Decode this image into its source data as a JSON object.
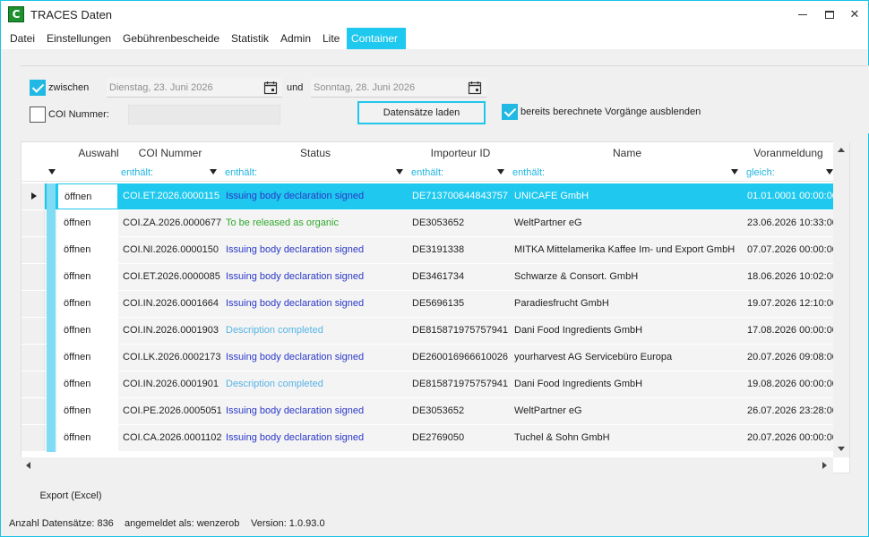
{
  "window": {
    "title": "TRACES Daten",
    "icon_letter": "C"
  },
  "menu": [
    "Datei",
    "Einstellungen",
    "Gebührenbescheide",
    "Statistik",
    "Admin",
    "Lite",
    "Container"
  ],
  "filters": {
    "between_label": "zwischen",
    "between_checked": true,
    "date_from": "Dienstag, 23. Juni 2026",
    "and_label": "und",
    "date_to": "Sonntag, 28. Juni 2026",
    "coi_label": "COI Nummer:",
    "coi_checked": false,
    "coi_value": "",
    "load_button": "Datensätze laden",
    "hide_calculated_label": "bereits berechnete Vorgänge ausblenden",
    "hide_calculated_checked": true
  },
  "grid": {
    "columns": [
      "Auswahl",
      "COI Nummer",
      "Status",
      "Importeur ID",
      "Name",
      "Voranmeldung"
    ],
    "filters": [
      "",
      "enthält:",
      "enthält:",
      "enthält:",
      "enthält:",
      "gleich:"
    ],
    "rows": [
      {
        "auswahl": "öffnen",
        "coi": "COI.ET.2026.0000115",
        "status": "Issuing body declaration signed",
        "status_style": "blue",
        "importer": "DE713700644843757",
        "name": "UNICAFE GmbH",
        "voranmeldung": "01.01.0001 00:00:00",
        "selected": true
      },
      {
        "auswahl": "öffnen",
        "coi": "COI.ZA.2026.0000677",
        "status": "To be released as organic",
        "status_style": "green",
        "importer": "DE3053652",
        "name": "WeltPartner eG",
        "voranmeldung": "23.06.2026 10:33:00"
      },
      {
        "auswahl": "öffnen",
        "coi": "COI.NI.2026.0000150",
        "status": "Issuing body declaration signed",
        "status_style": "blue",
        "importer": "DE3191338",
        "name": "MITKA Mittelamerika Kaffee Im- und Export GmbH",
        "voranmeldung": "07.07.2026 00:00:00"
      },
      {
        "auswahl": "öffnen",
        "coi": "COI.ET.2026.0000085",
        "status": "Issuing body declaration signed",
        "status_style": "blue",
        "importer": "DE3461734",
        "name": "Schwarze & Consort. GmbH",
        "voranmeldung": "18.06.2026 10:02:00"
      },
      {
        "auswahl": "öffnen",
        "coi": "COI.IN.2026.0001664",
        "status": "Issuing body declaration signed",
        "status_style": "blue",
        "importer": "DE5696135",
        "name": "Paradiesfrucht GmbH",
        "voranmeldung": "19.07.2026 12:10:00"
      },
      {
        "auswahl": "öffnen",
        "coi": "COI.IN.2026.0001903",
        "status": "Description completed",
        "status_style": "light",
        "importer": "DE815871975757941",
        "name": "Dani Food Ingredients GmbH",
        "voranmeldung": "17.08.2026 00:00:00"
      },
      {
        "auswahl": "öffnen",
        "coi": "COI.LK.2026.0002173",
        "status": "Issuing body declaration signed",
        "status_style": "blue",
        "importer": "DE260016966610026",
        "name": "yourharvest AG Servicebüro Europa",
        "voranmeldung": "20.07.2026 09:08:00"
      },
      {
        "auswahl": "öffnen",
        "coi": "COI.IN.2026.0001901",
        "status": "Description completed",
        "status_style": "light",
        "importer": "DE815871975757941",
        "name": "Dani Food Ingredients GmbH",
        "voranmeldung": "19.08.2026 00:00:00"
      },
      {
        "auswahl": "öffnen",
        "coi": "COI.PE.2026.0005051",
        "status": "Issuing body declaration signed",
        "status_style": "blue",
        "importer": "DE3053652",
        "name": "WeltPartner eG",
        "voranmeldung": "26.07.2026 23:28:00"
      },
      {
        "auswahl": "öffnen",
        "coi": "COI.CA.2026.0001102",
        "status": "Issuing body declaration signed",
        "status_style": "blue",
        "importer": "DE2769050",
        "name": "Tuchel & Sohn GmbH",
        "voranmeldung": "20.07.2026 00:00:00"
      }
    ]
  },
  "export_button": "Export (Excel)",
  "status": {
    "count": "Anzahl Datensätze: 836",
    "user": "angemeldet als: wenzerob",
    "version": "Version: 1.0.93.0"
  },
  "colors": {
    "accent": "#1ec8ee",
    "status_blue": "#2b38c8",
    "status_green": "#2ea82e",
    "status_light": "#56b4e6"
  }
}
